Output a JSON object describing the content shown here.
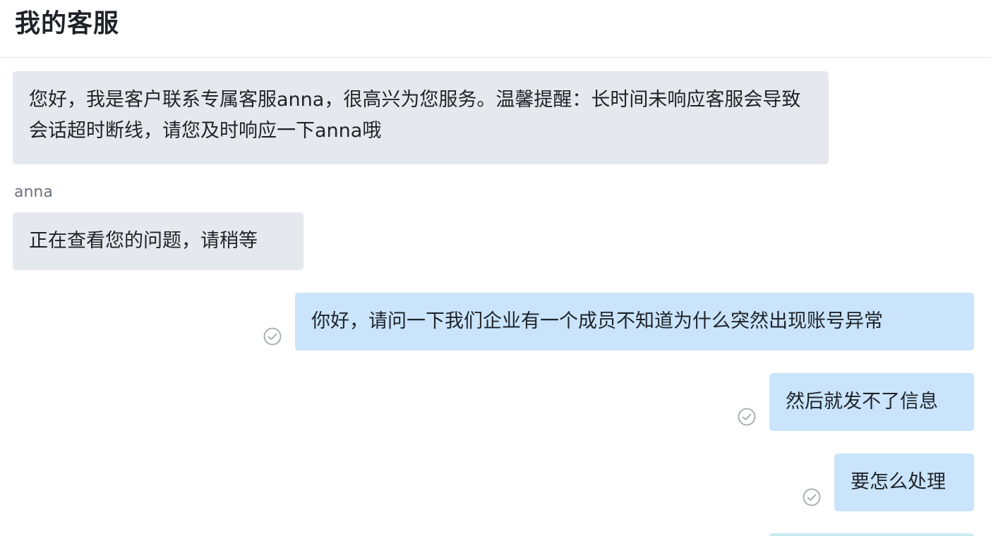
{
  "header": {
    "title": "我的客服"
  },
  "messages": [
    {
      "role": "agent",
      "text": "您好，我是客户联系专属客服anna，很高兴为您服务。温馨提醒：长时间未响应客服会导致会话超时断线，请您及时响应一下anna哦"
    },
    {
      "role": "agent",
      "sender": "anna",
      "text": "正在查看您的问题，请稍等"
    },
    {
      "role": "user",
      "text": "你好，请问一下我们企业有一个成员不知道为什么突然出现账号异常",
      "status_icon": "read-check-icon"
    },
    {
      "role": "user",
      "text": "然后就发不了信息",
      "status_icon": "read-check-icon"
    },
    {
      "role": "user",
      "text": "要怎么处理",
      "status_icon": "read-check-icon"
    }
  ],
  "colors": {
    "agent_bubble": "#e5e8ed",
    "user_bubble": "#c9e4fb",
    "sender_name": "#6b737c",
    "check_icon": "#a4a8ad"
  }
}
